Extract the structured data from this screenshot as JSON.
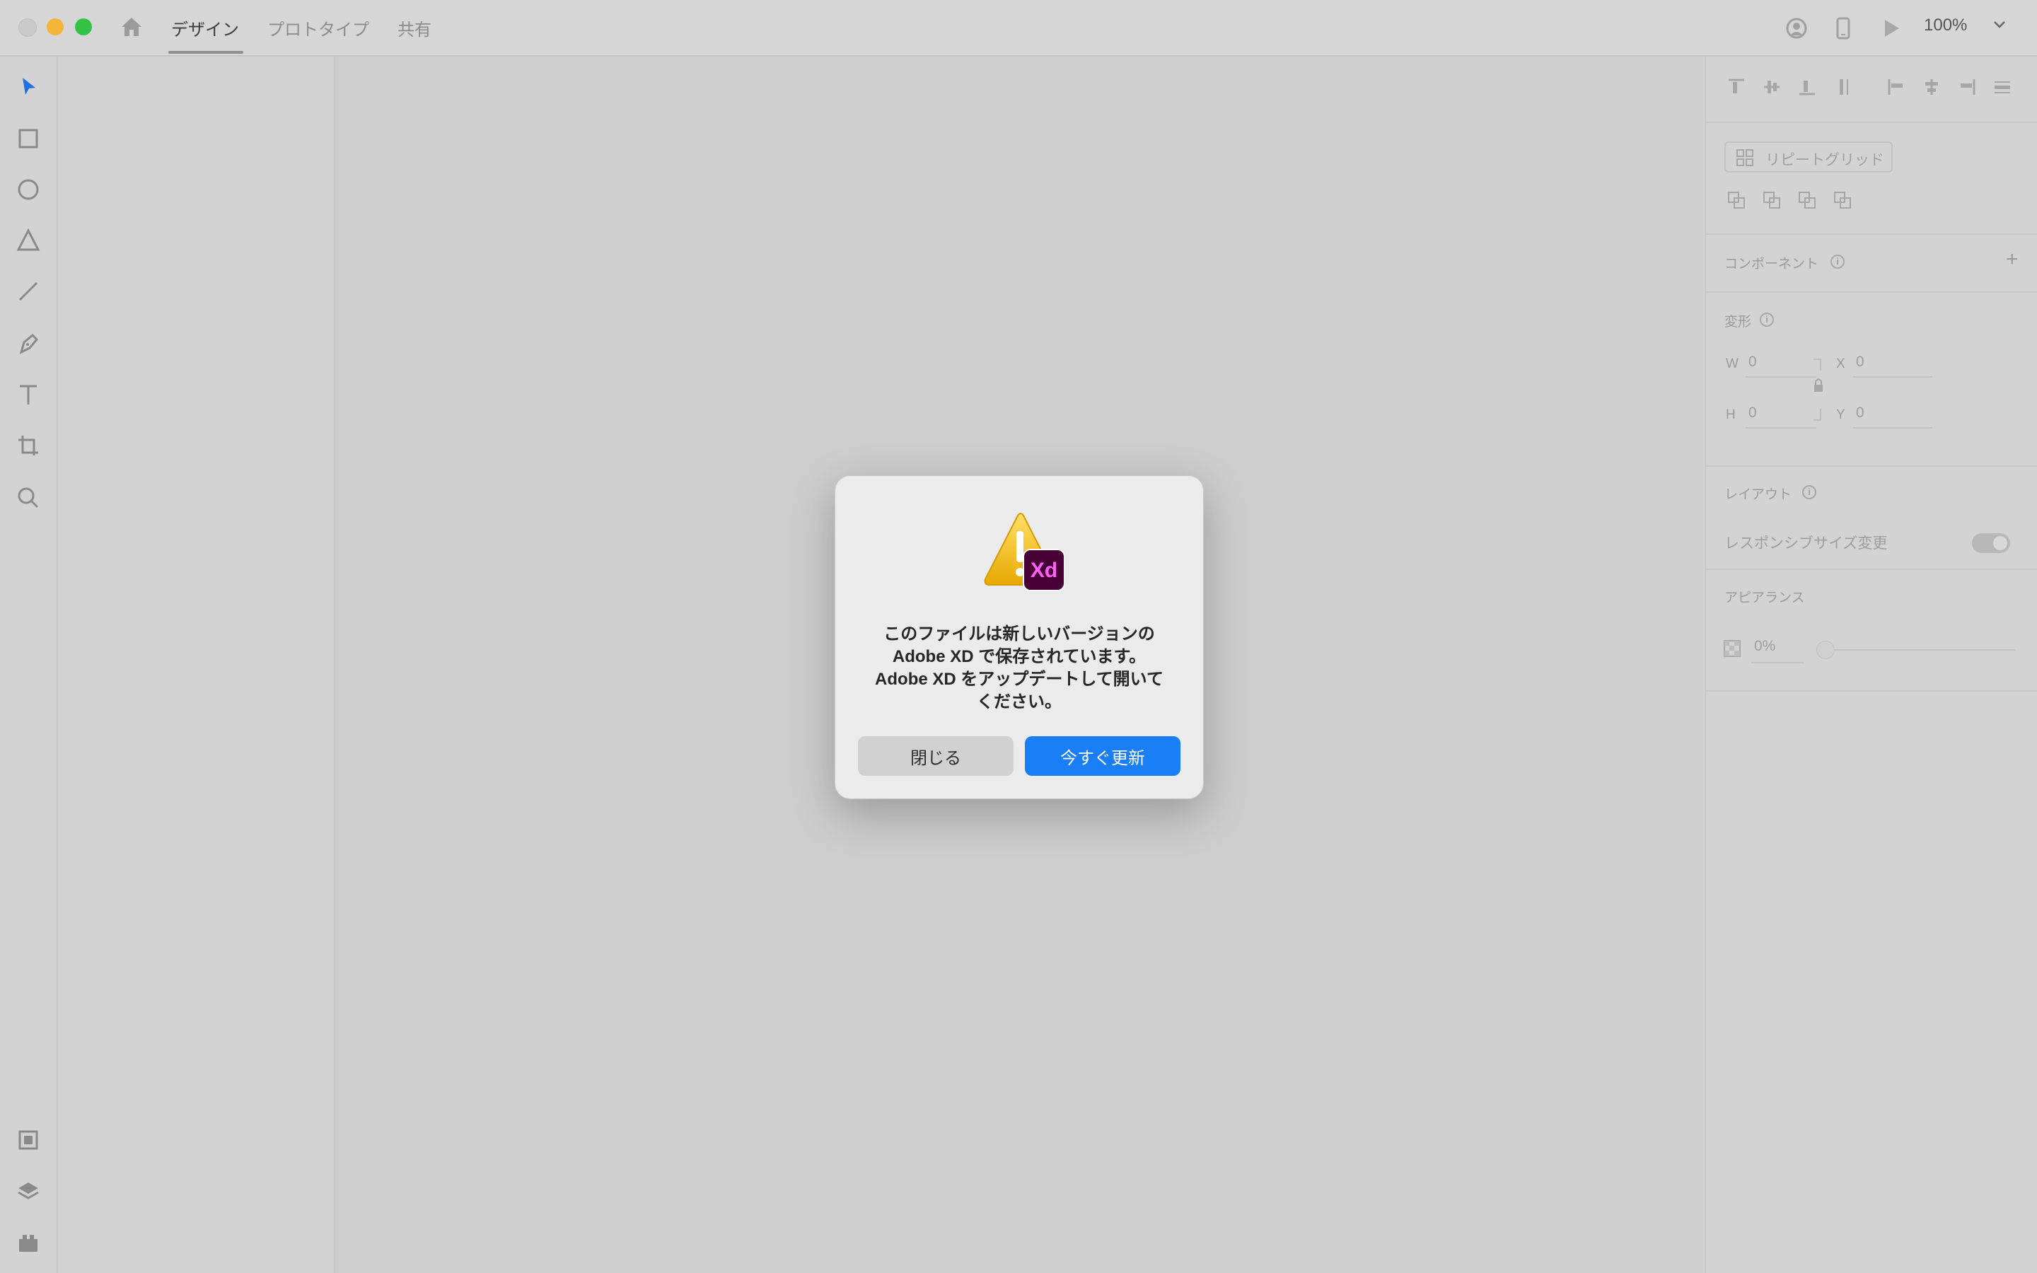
{
  "titlebar": {
    "tabs": [
      {
        "label": "デザイン",
        "active": true
      },
      {
        "label": "プロトタイプ",
        "active": false
      },
      {
        "label": "共有",
        "active": false
      }
    ],
    "zoom": "100%"
  },
  "toolbar": {
    "tools": [
      "select-tool",
      "rectangle-tool",
      "ellipse-tool",
      "polygon-tool",
      "line-tool",
      "pen-tool",
      "text-tool",
      "artboard-tool",
      "zoom-tool"
    ],
    "bottom": [
      "assets-panel",
      "layers-panel",
      "plugins-panel"
    ]
  },
  "properties": {
    "repeat_grid": "リピートグリッド",
    "component_label": "コンポーネント",
    "component_add": "+",
    "transform_label": "変形",
    "w_label": "W",
    "w_value": "0",
    "h_label": "H",
    "h_value": "0",
    "x_label": "X",
    "x_value": "0",
    "y_label": "Y",
    "y_value": "0",
    "layout_label": "レイアウト",
    "responsive_resize": "レスポンシブサイズ変更",
    "appearance_label": "アピアランス",
    "opacity_value": "0%"
  },
  "dialog": {
    "message_lines": [
      "このファイルは新しいバージョンの",
      "Adobe XD で保存されています。",
      "Adobe XD をアップデートして開いて",
      "ください。"
    ],
    "close_label": "閉じる",
    "update_label": "今すぐ更新",
    "badge_text": "Xd",
    "colors": {
      "primary": "#1a7ef7",
      "xd_badge_bg": "#470137",
      "xd_badge_text": "#ff61f6",
      "warning": "#f5c400"
    }
  }
}
